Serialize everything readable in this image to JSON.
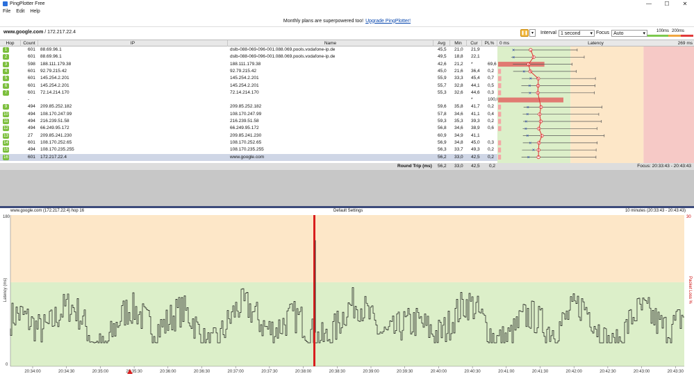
{
  "window": {
    "title": "PingPlotter Free",
    "buttons": {
      "minimize": "—",
      "maximize": "☐",
      "close": "✕"
    }
  },
  "menu": [
    "File",
    "Edit",
    "Help"
  ],
  "banner": {
    "text": "Monthly plans are superpowered too!",
    "link": "Upgrade PingPlotter!"
  },
  "toolbar": {
    "target_host": "www.google.com",
    "target_ip": " / 172.217.22.4",
    "interval_label": "Interval",
    "interval_value": "1 second",
    "focus_label": "Focus",
    "focus_value": "Auto",
    "scale_low": "100ms",
    "scale_high": "200ms"
  },
  "table": {
    "headers": {
      "hop": "Hop",
      "count": "Count",
      "ip": "IP",
      "name": "Name",
      "avg": "Avg",
      "min": "Min",
      "cur": "Cur",
      "pl": "PL%",
      "latency_start": "0 ms",
      "latency": "Latency",
      "latency_end": "269 ms"
    },
    "rows": [
      {
        "hop": "1",
        "count": "601",
        "ip": "88.69.96.1",
        "name": "dslb-088-069-096-001.088.069.pools.vodafone-ip.de",
        "avg": "45,5",
        "min": "21,0",
        "cur": "21,9",
        "pl": ""
      },
      {
        "hop": "2",
        "count": "601",
        "ip": "88.69.96.1",
        "name": "dslb-088-069-096-001.088.069.pools.vodafone-ip.de",
        "avg": "49,5",
        "min": "18,8",
        "cur": "22,1",
        "pl": ""
      },
      {
        "hop": "3",
        "count": "598",
        "ip": "188.111.179.38",
        "name": "188.111.179.38",
        "avg": "42,6",
        "min": "21,2",
        "cur": "*",
        "pl": "69,6"
      },
      {
        "hop": "4",
        "count": "601",
        "ip": "92.79.215.42",
        "name": "92.79.215.42",
        "avg": "45,0",
        "min": "21,6",
        "cur": "36,4",
        "pl": "0,2"
      },
      {
        "hop": "5",
        "count": "601",
        "ip": "145.254.2.201",
        "name": "145.254.2.201",
        "avg": "55,9",
        "min": "33,3",
        "cur": "45,4",
        "pl": "0,7"
      },
      {
        "hop": "6",
        "count": "601",
        "ip": "145.254.2.201",
        "name": "145.254.2.201",
        "avg": "55,7",
        "min": "32,8",
        "cur": "44,1",
        "pl": "0,5"
      },
      {
        "hop": "7",
        "count": "601",
        "ip": "72.14.214.170",
        "name": "72.14.214.170",
        "avg": "55,3",
        "min": "32,6",
        "cur": "44,6",
        "pl": "0,3"
      },
      {
        "hop": "",
        "count": "-",
        "ip": "",
        "name": "",
        "avg": "",
        "min": "",
        "cur": "*",
        "pl": "100,0"
      },
      {
        "hop": "9",
        "count": "494",
        "ip": "209.85.252.182",
        "name": "209.85.252.182",
        "avg": "59,6",
        "min": "35,8",
        "cur": "41,7",
        "pl": "0,2"
      },
      {
        "hop": "10",
        "count": "494",
        "ip": "108.170.247.99",
        "name": "108.170.247.99",
        "avg": "57,8",
        "min": "34,6",
        "cur": "41,1",
        "pl": "0,4"
      },
      {
        "hop": "11",
        "count": "494",
        "ip": "216.239.51.58",
        "name": "216.239.51.58",
        "avg": "59,3",
        "min": "35,3",
        "cur": "39,3",
        "pl": "0,2"
      },
      {
        "hop": "12",
        "count": "494",
        "ip": "66.249.95.172",
        "name": "66.249.95.172",
        "avg": "56,8",
        "min": "34,6",
        "cur": "38,9",
        "pl": "0,6"
      },
      {
        "hop": "13",
        "count": "27",
        "ip": "209.85.241.230",
        "name": "209.85.241.230",
        "avg": "60,9",
        "min": "34,9",
        "cur": "41,1",
        "pl": ""
      },
      {
        "hop": "14",
        "count": "601",
        "ip": "108.170.252.65",
        "name": "108.170.252.65",
        "avg": "56,9",
        "min": "34,8",
        "cur": "45,0",
        "pl": "0,3"
      },
      {
        "hop": "15",
        "count": "494",
        "ip": "108.170.235.255",
        "name": "108.170.235.255",
        "avg": "56,3",
        "min": "33,7",
        "cur": "49,3",
        "pl": "0,2"
      },
      {
        "hop": "16",
        "count": "601",
        "ip": "172.217.22.4",
        "name": "www.google.com",
        "avg": "56,2",
        "min": "33,0",
        "cur": "42,5",
        "pl": "0,2"
      }
    ],
    "round_trip": {
      "label": "Round Trip (ms)",
      "avg": "56,2",
      "min": "33,0",
      "cur": "42,5",
      "pl": "0,2"
    },
    "focus_range": "Focus: 20:33:43 - 20:43:43"
  },
  "graph": {
    "target_label": "www.google.com (172.217.22.4) hop 16",
    "settings_label": "Default Settings",
    "range_label": "10 minutes (20:33:43 - 20:43:43)",
    "y_max_label": "180",
    "y_min_label": "0",
    "y_right_label": "30",
    "y_axis_title": "Latency (ms)",
    "y_right_title": "Packet Loss %",
    "time_ticks": [
      "20:34:00",
      "20:34:30",
      "20:35:00",
      "20:35:30",
      "20:36:00",
      "20:36:30",
      "20:37:00",
      "20:37:30",
      "20:38:00",
      "20:38:30",
      "20:39:00",
      "20:39:30",
      "20:40:00",
      "20:40:30",
      "20:41:00",
      "20:41:30",
      "20:42:00",
      "20:42:30",
      "20:43:00",
      "20:43:30"
    ]
  },
  "colors": {
    "green_zone": "#dcefc9",
    "orange_zone": "#fde7c8",
    "red_zone": "#f6c9c6",
    "hop_badge": "#7cbf3d",
    "loss_line": "#d81e1e"
  }
}
